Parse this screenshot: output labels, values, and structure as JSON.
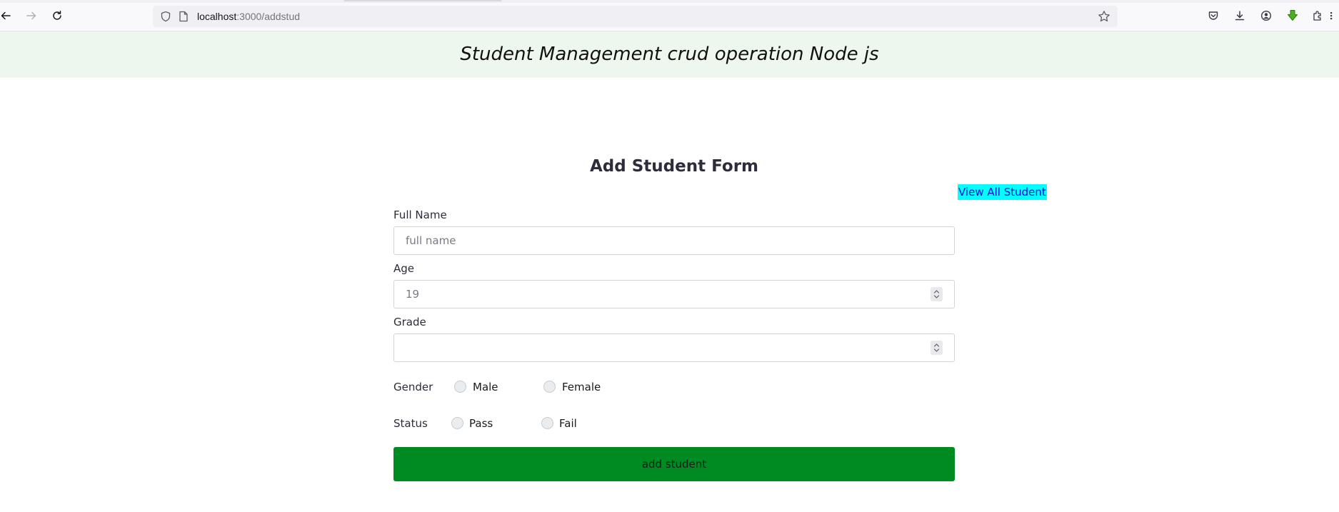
{
  "browser": {
    "url_host": "localhost",
    "url_path": ":3000/addstud"
  },
  "header": {
    "title": "Student Management crud operation Node js"
  },
  "form": {
    "heading": "Add Student Form",
    "view_all_label": "View All Student",
    "full_name": {
      "label": "Full Name",
      "placeholder": "full name",
      "value": ""
    },
    "age": {
      "label": "Age",
      "placeholder": "19",
      "value": ""
    },
    "grade": {
      "label": "Grade",
      "placeholder": "",
      "value": ""
    },
    "gender": {
      "label": "Gender",
      "options": [
        "Male",
        "Female"
      ],
      "selected": null
    },
    "status": {
      "label": "Status",
      "options": [
        "Pass",
        "Fail"
      ],
      "selected": null
    },
    "submit_label": "add student"
  },
  "colors": {
    "header_band": "#eef7ee",
    "view_all_highlight": "#00ffff",
    "link_text": "#0b0bd6",
    "submit_button": "#008b22"
  }
}
